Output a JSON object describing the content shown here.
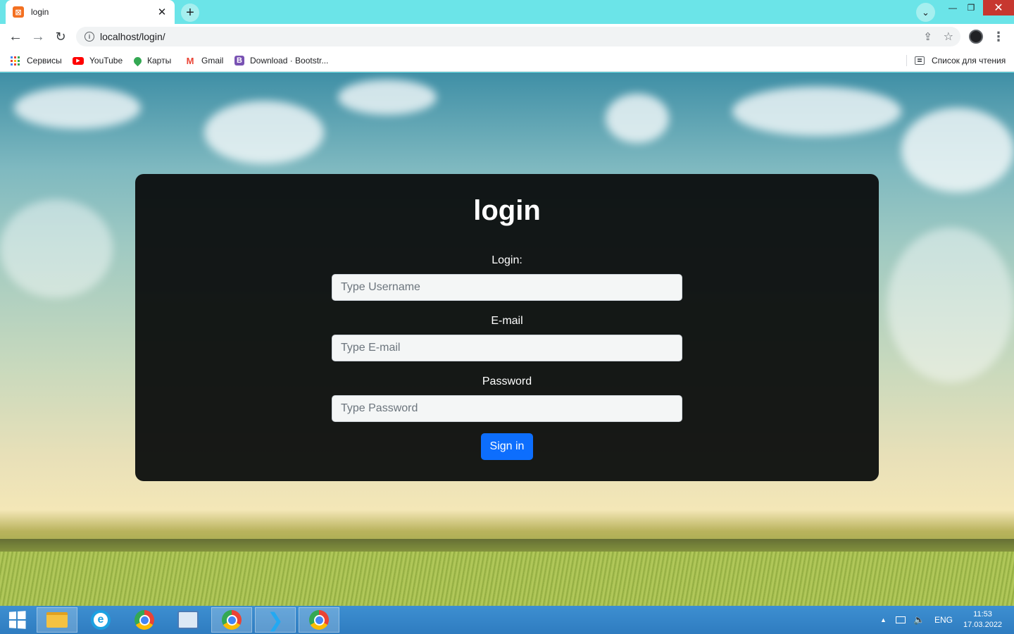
{
  "browser": {
    "tab": {
      "title": "login",
      "favicon": "xampp-icon"
    },
    "url": "localhost/login/",
    "bookmarks": [
      {
        "label": "Сервисы",
        "icon": "apps-grid-icon"
      },
      {
        "label": "YouTube",
        "icon": "youtube-icon"
      },
      {
        "label": "Карты",
        "icon": "maps-icon"
      },
      {
        "label": "Gmail",
        "icon": "gmail-icon"
      },
      {
        "label": "Download · Bootstr...",
        "icon": "bootstrap-icon"
      }
    ],
    "reading_list": "Список для чтения"
  },
  "form": {
    "title": "login",
    "login_label": "Login:",
    "username_placeholder": "Type Username",
    "email_label": "E-mail",
    "email_placeholder": "Type E-mail",
    "password_label": "Password",
    "password_placeholder": "Type Password",
    "submit_label": "Sign in"
  },
  "taskbar": {
    "apps": [
      "start-icon",
      "file-explorer-icon",
      "internet-explorer-icon",
      "chrome-icon",
      "control-panel-icon",
      "chrome-profile-icon",
      "vscode-icon",
      "chrome-active-icon"
    ],
    "language": "ENG",
    "time": "11:53",
    "date": "17.03.2022"
  },
  "colors": {
    "tabbar": "#6be4e8",
    "card_bg": "#0a0c0c",
    "primary_button": "#0d6efd",
    "taskbar": "#2f7cc0"
  }
}
